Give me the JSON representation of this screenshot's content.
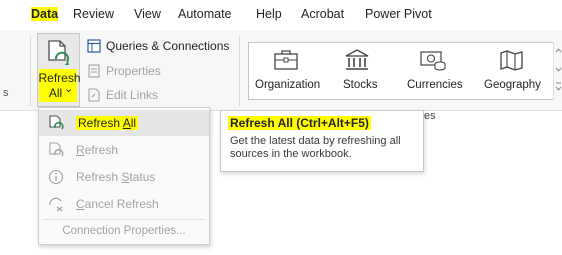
{
  "tabs": [
    {
      "label": "Data",
      "active": true,
      "highlighted": true
    },
    {
      "label": "Review"
    },
    {
      "label": "View"
    },
    {
      "label": "Automate"
    },
    {
      "label": "Help"
    },
    {
      "label": "Acrobat"
    },
    {
      "label": "Power Pivot"
    }
  ],
  "queries": {
    "refresh_all_line1": "Refresh",
    "refresh_all_line2": "All",
    "refresh_all_chevron": "⌄",
    "queries_connections": "Queries & Connections",
    "properties": "Properties",
    "edit_links": "Edit Links"
  },
  "data_types": {
    "items": [
      {
        "label": "Organization",
        "icon": "briefcase-icon"
      },
      {
        "label": "Stocks",
        "icon": "bank-icon"
      },
      {
        "label": "Currencies",
        "icon": "currency-icon"
      },
      {
        "label": "Geography",
        "icon": "map-icon"
      }
    ],
    "group_label_suffix": "es"
  },
  "left_edge_text": "s",
  "menu": {
    "items": [
      {
        "label": "Refresh All",
        "accel": "A",
        "icon": "refresh-all-icon",
        "selected": true,
        "highlighted": true
      },
      {
        "label": "Refresh",
        "accel": "R",
        "icon": "refresh-icon",
        "disabled": true
      },
      {
        "label": "Refresh Status",
        "accel": "S",
        "icon": "info-icon",
        "disabled": true
      },
      {
        "label": "Cancel Refresh",
        "accel": "C",
        "icon": "cancel-refresh-icon",
        "disabled": true
      }
    ],
    "footer": "Connection Properties..."
  },
  "tooltip": {
    "title": "Refresh All (Ctrl+Alt+F5)",
    "body": "Get the latest data by refreshing all sources in the workbook."
  },
  "colors": {
    "highlight": "#ffff00",
    "accent_green": "#2e8b57",
    "text": "#242424",
    "disabled": "#a3a3a3"
  }
}
